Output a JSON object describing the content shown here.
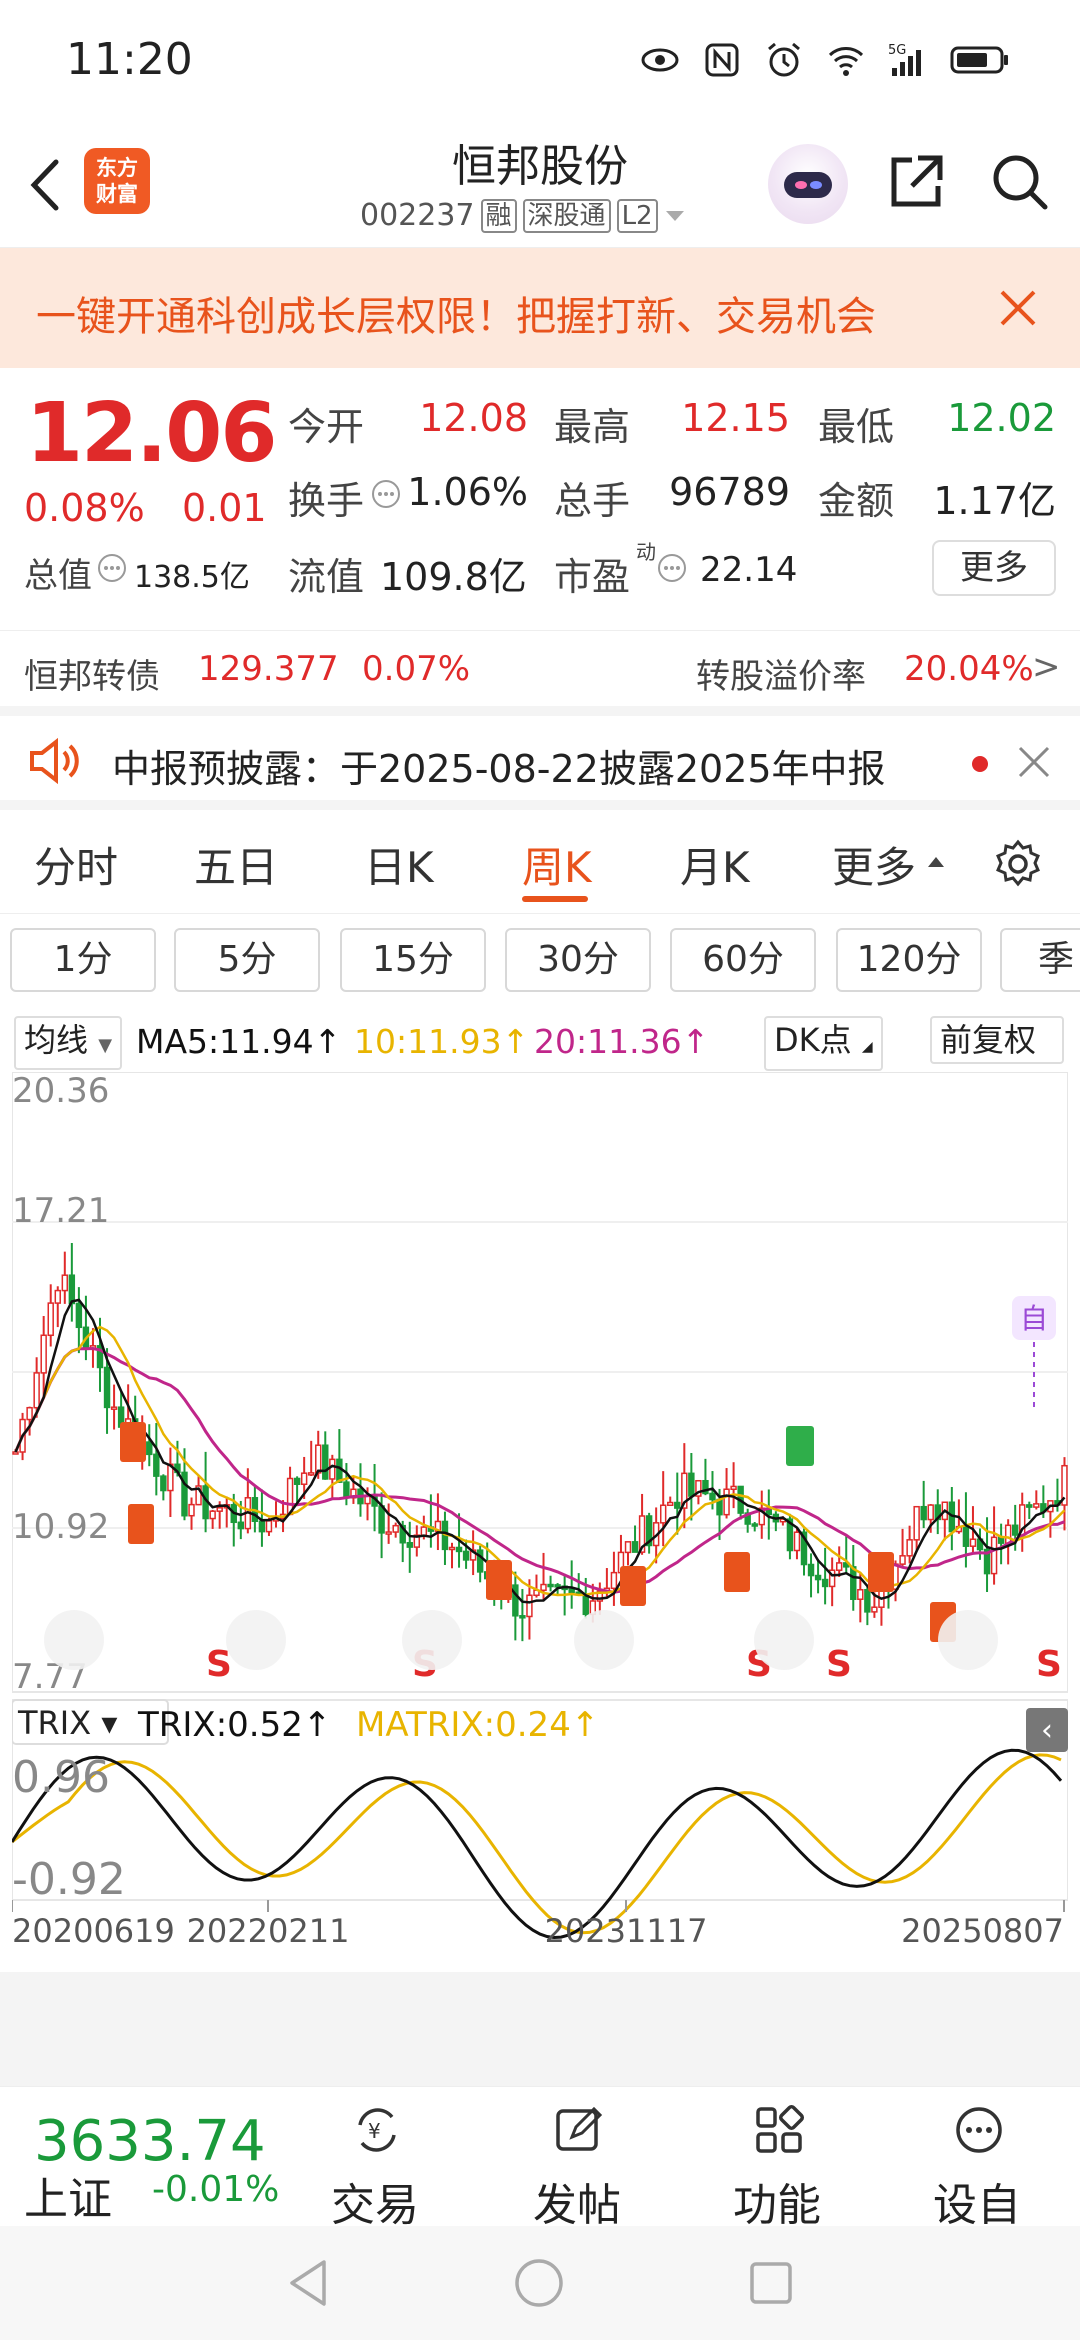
{
  "status_bar": {
    "time": "11:20"
  },
  "header": {
    "logo_text_line1": "东方",
    "logo_text_line2": "财富",
    "stock_name": "恒邦股份",
    "stock_code": "002237",
    "tags": [
      "融",
      "深股通",
      "L2"
    ]
  },
  "banner": {
    "text": "一键开通科创成长层权限！把握打新、交易机会"
  },
  "quote": {
    "price": "12.06",
    "change_pct": "0.08%",
    "change_val": "0.01",
    "open_label": "今开",
    "open": "12.08",
    "high_label": "最高",
    "high": "12.15",
    "low_label": "最低",
    "low": "12.02",
    "turnover_label": "换手",
    "turnover": "1.06%",
    "volume_label": "总手",
    "volume": "96789",
    "amount_label": "金额",
    "amount": "1.17亿",
    "mktcap_label": "总值",
    "mktcap": "138.5亿",
    "float_label": "流值",
    "float": "109.8亿",
    "pe_label": "市盈",
    "pe_sup": "动",
    "pe": "22.14",
    "more_label": "更多"
  },
  "bond": {
    "name": "恒邦转债",
    "price": "129.377",
    "pct": "0.07%",
    "premium_label": "转股溢价率",
    "premium": "20.04%",
    "arrow": ">"
  },
  "notice": {
    "text": "中报预披露：于2025-08-22披露2025年中报"
  },
  "tabs": [
    "分时",
    "五日",
    "日K",
    "周K",
    "月K",
    "更多"
  ],
  "active_tab": "周K",
  "periods": [
    "1分",
    "5分",
    "15分",
    "30分",
    "60分",
    "120分",
    "季"
  ],
  "ma": {
    "selector": "均线",
    "ma5": "MA5:11.94↑",
    "ma10": "10:11.93↑",
    "ma20": "20:11.36↑",
    "dk": "DK点",
    "adjust": "前复权"
  },
  "colors": {
    "ma5": "#111111",
    "ma10": "#e8b400",
    "ma20": "#c0268a",
    "up": "#e02a2a",
    "down": "#1a9a3a",
    "accent": "#e8531c"
  },
  "chart_axis": {
    "y_top": "20.36",
    "y_2": "17.21",
    "y_4": "10.92",
    "y_bottom": "7.77",
    "self_label": "自"
  },
  "trix": {
    "selector": "TRIX",
    "trix": "TRIX:0.52↑",
    "matrix": "MATRIX:0.24↑",
    "y_top": "0.96",
    "y_bottom": "-0.92"
  },
  "chart_data": {
    "type": "line",
    "x": [
      "20200619",
      "20220211",
      "20231117",
      "20250807"
    ],
    "y_ticks": [
      7.77,
      10.92,
      17.21,
      20.36
    ],
    "ylim": [
      7.77,
      20.36
    ]
  },
  "bottom_nav": {
    "index_value": "3633.74",
    "index_name": "上证",
    "index_change": "-0.01%",
    "items": [
      "交易",
      "发帖",
      "功能",
      "设自选"
    ]
  }
}
